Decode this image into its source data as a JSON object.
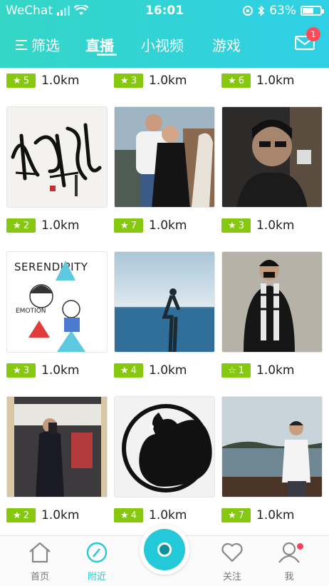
{
  "status": {
    "carrier": "WeChat",
    "time": "16:01",
    "battery": "63%",
    "battery_level": 0.63
  },
  "nav": {
    "filter_label": "筛选",
    "tabs": [
      {
        "label": "直播"
      },
      {
        "label": "小视频"
      },
      {
        "label": "游戏"
      }
    ],
    "mail_badge": "1"
  },
  "rows": [
    {
      "items": [
        {
          "stars": "5",
          "distance": "1.0km"
        },
        {
          "stars": "3",
          "distance": "1.0km"
        },
        {
          "stars": "6",
          "distance": "1.0km"
        }
      ]
    },
    {
      "items": [
        {
          "stars": "2",
          "distance": "1.0km"
        },
        {
          "stars": "7",
          "distance": "1.0km"
        },
        {
          "stars": "3",
          "distance": "1.0km"
        }
      ]
    },
    {
      "items": [
        {
          "stars": "3",
          "distance": "1.0km"
        },
        {
          "stars": "4",
          "distance": "1.0km"
        },
        {
          "stars": "1",
          "distance": "1.0km"
        }
      ]
    },
    {
      "items": [
        {
          "stars": "2",
          "distance": "1.0km"
        },
        {
          "stars": "4",
          "distance": "1.0km"
        },
        {
          "stars": "7",
          "distance": "1.0km"
        }
      ]
    }
  ],
  "thumbs": {
    "serendipity_title": "SERENDIPITY",
    "serendipity_sub": "EMOTION"
  },
  "bottom": {
    "home": "首页",
    "nearby": "附近",
    "follow": "关注",
    "me": "我"
  }
}
